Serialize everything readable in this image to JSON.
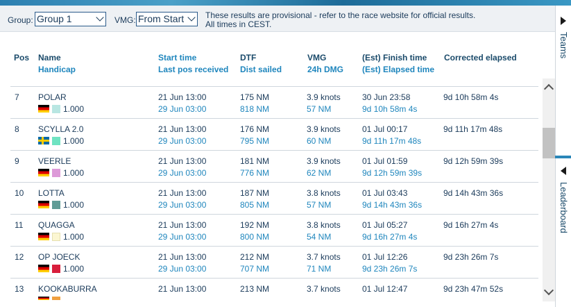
{
  "controls": {
    "group_label": "Group:",
    "group_value": "Group 1",
    "vmg_label": "VMG:",
    "vmg_value": "From Start",
    "notice_line1": "These results are provisional - refer to the race website for official results.",
    "notice_line2": "All times in CEST."
  },
  "headers": {
    "pos": "Pos",
    "name": "Name",
    "handicap": "Handicap",
    "start_time": "Start time",
    "last_pos": "Last pos received",
    "dtf": "DTF",
    "dist_sailed": "Dist sailed",
    "vmg": "VMG",
    "dmg": "24h DMG",
    "finish_time": "(Est) Finish time",
    "elapsed_time": "(Est) Elapsed time",
    "corrected": "Corrected elapsed"
  },
  "rows": [
    {
      "pos": "7",
      "name": "POLAR",
      "flag": "de",
      "swatch": "#b8e6e2",
      "handicap": "1.000",
      "start": "21 Jun 13:00",
      "last": "29 Jun 03:00",
      "dtf": "175 NM",
      "sailed": "818 NM",
      "vmg": "3.9 knots",
      "dmg": "57 NM",
      "finish": "30 Jun 23:58",
      "elapsed": "9d 10h 58m 4s",
      "corrected": "9d 10h 58m 4s"
    },
    {
      "pos": "8",
      "name": "SCYLLA 2.0",
      "flag": "se",
      "swatch": "#6fe3c2",
      "handicap": "1.000",
      "start": "21 Jun 13:00",
      "last": "29 Jun 03:00",
      "dtf": "176 NM",
      "sailed": "795 NM",
      "vmg": "3.9 knots",
      "dmg": "60 NM",
      "finish": "01 Jul 00:17",
      "elapsed": "9d 11h 17m 48s",
      "corrected": "9d 11h 17m 48s"
    },
    {
      "pos": "9",
      "name": "VEERLE",
      "flag": "de",
      "swatch": "#dd9ad8",
      "handicap": "1.000",
      "start": "21 Jun 13:00",
      "last": "29 Jun 03:00",
      "dtf": "181 NM",
      "sailed": "776 NM",
      "vmg": "3.9 knots",
      "dmg": "62 NM",
      "finish": "01 Jul 01:59",
      "elapsed": "9d 12h 59m 39s",
      "corrected": "9d 12h 59m 39s"
    },
    {
      "pos": "10",
      "name": "LOTTA",
      "flag": "de",
      "swatch": "#5f9c96",
      "handicap": "1.000",
      "start": "21 Jun 13:00",
      "last": "29 Jun 03:00",
      "dtf": "187 NM",
      "sailed": "805 NM",
      "vmg": "3.8 knots",
      "dmg": "57 NM",
      "finish": "01 Jul 03:43",
      "elapsed": "9d 14h 43m 36s",
      "corrected": "9d 14h 43m 36s"
    },
    {
      "pos": "11",
      "name": "QUAGGA",
      "flag": "de",
      "swatch": "#fbf6d2",
      "handicap": "1.000",
      "start": "21 Jun 13:00",
      "last": "29 Jun 03:00",
      "dtf": "192 NM",
      "sailed": "800 NM",
      "vmg": "3.8 knots",
      "dmg": "54 NM",
      "finish": "01 Jul 05:27",
      "elapsed": "9d 16h 27m 4s",
      "corrected": "9d 16h 27m 4s"
    },
    {
      "pos": "12",
      "name": "OP JOECK",
      "flag": "de",
      "swatch": "#d81e3c",
      "handicap": "1.000",
      "start": "21 Jun 13:00",
      "last": "29 Jun 03:00",
      "dtf": "212 NM",
      "sailed": "707 NM",
      "vmg": "3.7 knots",
      "dmg": "71 NM",
      "finish": "01 Jul 12:26",
      "elapsed": "9d 23h 26m 7s",
      "corrected": "9d 23h 26m 7s"
    },
    {
      "pos": "13",
      "name": "KOOKABURRA",
      "flag": "de",
      "swatch": "#f0a040",
      "handicap": "",
      "start": "21 Jun 13:00",
      "last": "",
      "dtf": "213 NM",
      "sailed": "",
      "vmg": "3.7 knots",
      "dmg": "",
      "finish": "01 Jul 12:47",
      "elapsed": "",
      "corrected": "9d 23h 47m 52s"
    }
  ],
  "side": {
    "teams_label": "Teams",
    "leaderboard_label": "Leaderboard"
  }
}
